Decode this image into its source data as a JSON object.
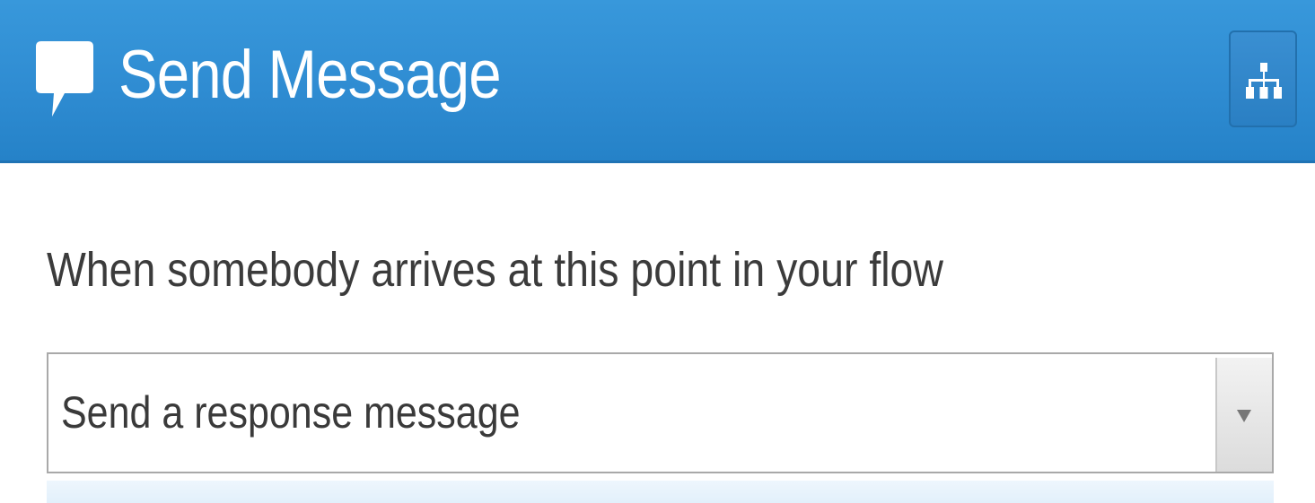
{
  "header": {
    "title": "Send Message",
    "icon": "speech-bubble-icon",
    "background_color": "#2f8cd2",
    "flow_button_icon": "sitemap-icon"
  },
  "body": {
    "prompt": "When somebody arrives at this point in your flow"
  },
  "action_select": {
    "selected_value": "Send a response message",
    "arrow_icon": "caret-down-icon"
  }
}
